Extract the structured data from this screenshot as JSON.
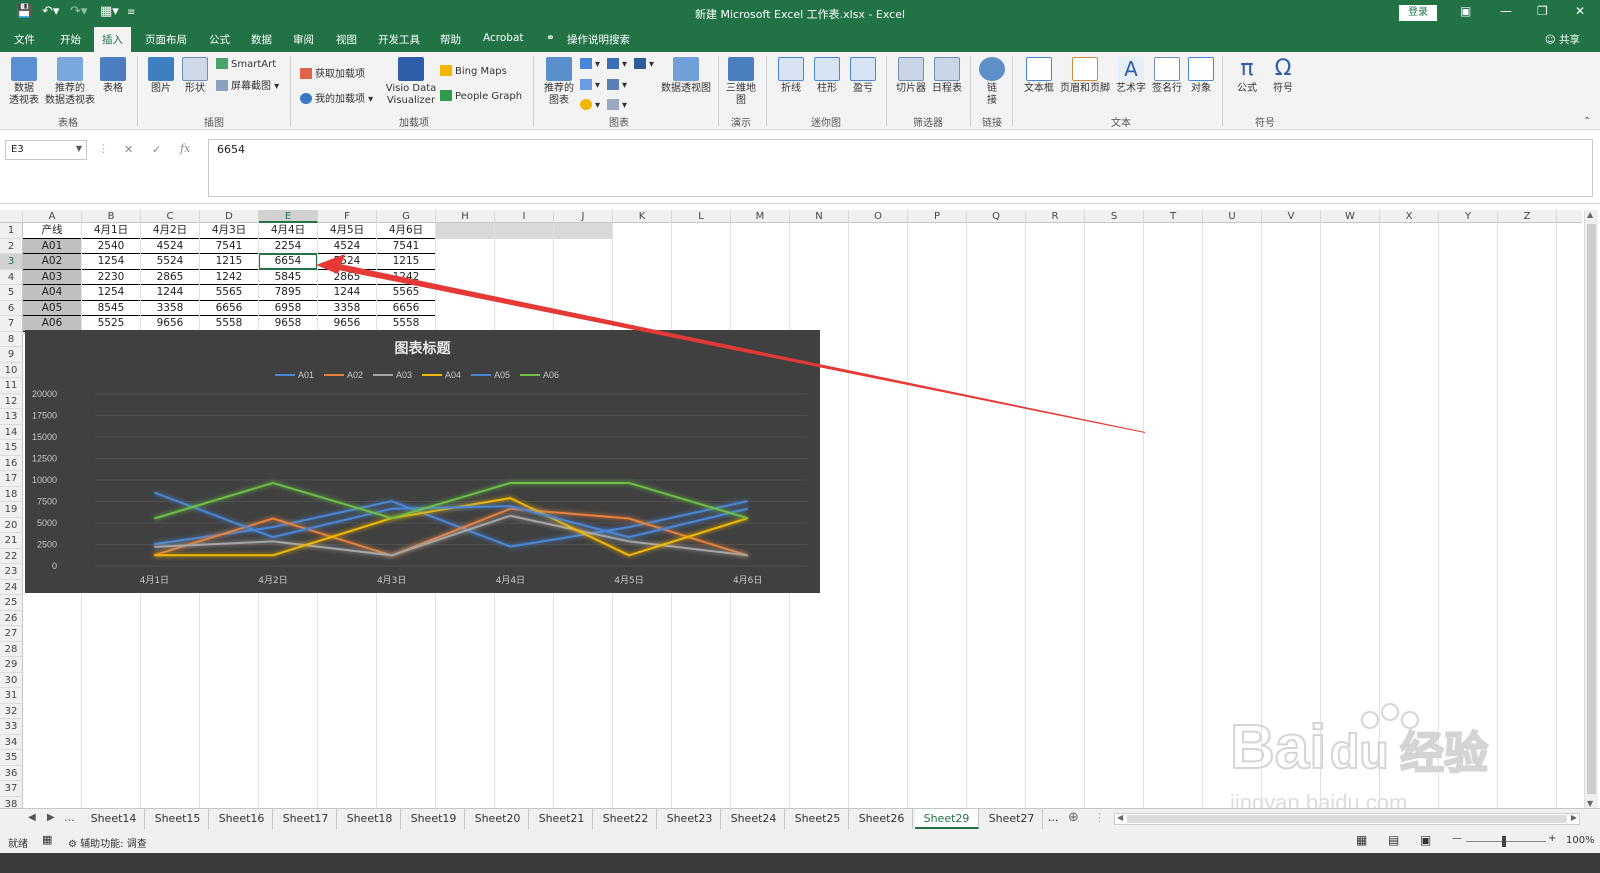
{
  "window": {
    "title": "新建 Microsoft Excel 工作表.xlsx  -  Excel",
    "login_label": "登录",
    "controls": [
      "ribbon-display-icon",
      "minimize-icon",
      "restore-icon",
      "close-icon"
    ]
  },
  "menu": {
    "tabs": [
      "文件",
      "开始",
      "插入",
      "页面布局",
      "公式",
      "数据",
      "审阅",
      "视图",
      "开发工具",
      "帮助",
      "Acrobat"
    ],
    "active_tab": "插入",
    "search_label": "操作说明搜索",
    "share_label": "共享"
  },
  "ribbon": {
    "groups": {
      "tables": "表格",
      "illustrations": "插图",
      "addins": "加载项",
      "charts": "图表",
      "tours": "演示",
      "sparklines": "迷你图",
      "filters": "筛选器",
      "links": "链接",
      "text": "文本",
      "symbols": "符号"
    },
    "buttons": {
      "pivot_table": "数据\n透视表",
      "recommended_pivot": "推荐的\n数据透视表",
      "table": "表格",
      "picture": "图片",
      "shapes": "形状",
      "smartart": "SmartArt",
      "screenshot": "屏幕截图",
      "get_addins": "获取加载项",
      "my_addins": "我的加载项",
      "visio": "Visio Data\nVisualizer",
      "bing_maps": "Bing Maps",
      "people_graph": "People Graph",
      "recommended_charts": "推荐的\n图表",
      "pivot_chart": "数据透视图",
      "map_3d": "三维地\n图",
      "spark_line": "折线",
      "spark_column": "柱形",
      "spark_winloss": "盈亏",
      "slicer": "切片器",
      "timeline": "日程表",
      "link": "链\n接",
      "textbox": "文本框",
      "header_footer": "页眉和页脚",
      "wordart": "艺术字",
      "signature": "签名行",
      "object": "对象",
      "equation": "公式",
      "symbol": "符号"
    }
  },
  "formula_bar": {
    "name_box": "E3",
    "value": "6654",
    "fx": "fx"
  },
  "sheet": {
    "columns": [
      "A",
      "B",
      "C",
      "D",
      "E",
      "F",
      "G",
      "H",
      "I",
      "J",
      "K",
      "L",
      "M",
      "N",
      "O",
      "P",
      "Q",
      "R",
      "S",
      "T",
      "U",
      "V",
      "W",
      "X",
      "Y",
      "Z"
    ],
    "selected_column": "E",
    "selected_row": 3,
    "row_count": 38,
    "table": {
      "headers": [
        "产线",
        "4月1日",
        "4月2日",
        "4月3日",
        "4月4日",
        "4月5日",
        "4月6日"
      ],
      "rows": [
        [
          "A01",
          "2540",
          "4524",
          "7541",
          "2254",
          "4524",
          "7541"
        ],
        [
          "A02",
          "1254",
          "5524",
          "1215",
          "6654",
          "5524",
          "1215"
        ],
        [
          "A03",
          "2230",
          "2865",
          "1242",
          "5845",
          "2865",
          "1242"
        ],
        [
          "A04",
          "1254",
          "1244",
          "5565",
          "7895",
          "1244",
          "5565"
        ],
        [
          "A05",
          "8545",
          "3358",
          "6656",
          "6958",
          "3358",
          "6656"
        ],
        [
          "A06",
          "5525",
          "9656",
          "5558",
          "9658",
          "9656",
          "5558"
        ]
      ]
    }
  },
  "chart_data": {
    "type": "line",
    "title": "图表标题",
    "categories": [
      "4月1日",
      "4月2日",
      "4月3日",
      "4月4日",
      "4月5日",
      "4月6日"
    ],
    "series": [
      {
        "name": "A01",
        "color": "#4a86d8",
        "values": [
          2540,
          4524,
          7541,
          2254,
          4524,
          7541
        ]
      },
      {
        "name": "A02",
        "color": "#e8803a",
        "values": [
          1254,
          5524,
          1215,
          6654,
          5524,
          1215
        ]
      },
      {
        "name": "A03",
        "color": "#a5a5a5",
        "values": [
          2230,
          2865,
          1242,
          5845,
          2865,
          1242
        ]
      },
      {
        "name": "A04",
        "color": "#f2b600",
        "values": [
          1254,
          1244,
          5565,
          7895,
          1244,
          5565
        ]
      },
      {
        "name": "A05",
        "color": "#4a86d8",
        "values": [
          8545,
          3358,
          6656,
          6958,
          3358,
          6656
        ]
      },
      {
        "name": "A06",
        "color": "#6cbe45",
        "values": [
          5525,
          9656,
          5558,
          9658,
          9656,
          5558
        ]
      }
    ],
    "yticks": [
      "0",
      "2500",
      "5000",
      "7500",
      "10000",
      "12500",
      "15000",
      "17500",
      "20000"
    ],
    "ylim": [
      0,
      20000
    ],
    "legend": "top",
    "grid": true,
    "background": "#404040"
  },
  "sheet_tabs": {
    "ellipsis": "...",
    "tabs": [
      "Sheet14",
      "Sheet15",
      "Sheet16",
      "Sheet17",
      "Sheet18",
      "Sheet19",
      "Sheet20",
      "Sheet21",
      "Sheet22",
      "Sheet23",
      "Sheet24",
      "Sheet25",
      "Sheet26",
      "Sheet29",
      "Sheet27"
    ],
    "active": "Sheet29",
    "more": "..."
  },
  "status": {
    "ready": "就绪",
    "accessibility": "辅助功能: 调查",
    "zoom": "100%"
  },
  "annotation": {
    "arrow_color": "#e53935"
  },
  "watermark": {
    "text": "Baidu经验",
    "url": "jingyan.baidu.com"
  }
}
